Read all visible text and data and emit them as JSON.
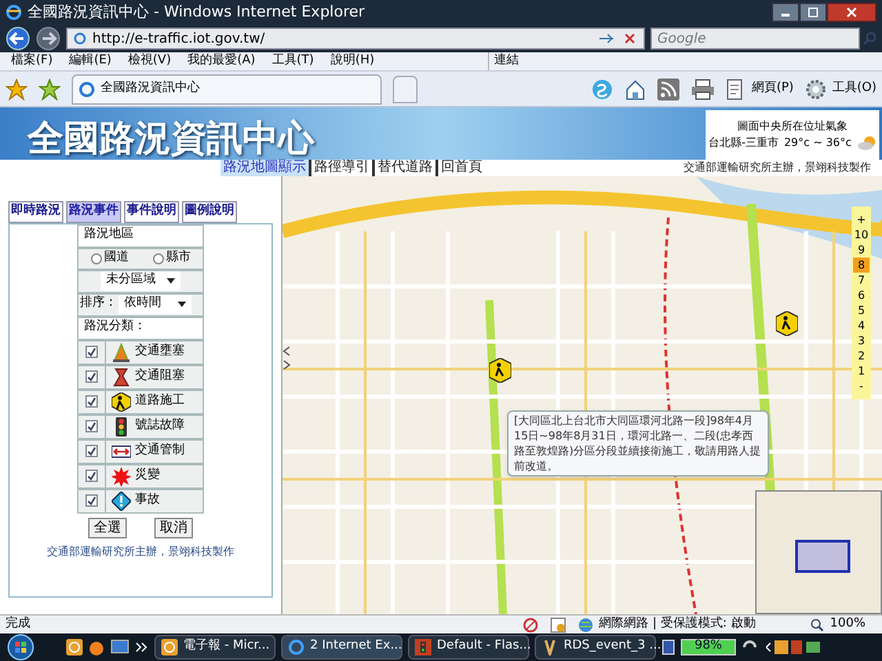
{
  "window": {
    "title": "全國路況資訊中心 - Windows Internet Explorer"
  },
  "address_bar": {
    "url": "http://e-traffic.iot.gov.tw/"
  },
  "search": {
    "placeholder": "Google"
  },
  "menu": [
    "檔案(F)",
    "編輯(E)",
    "檢視(V)",
    "我的最愛(A)",
    "工具(T)",
    "說明(H)"
  ],
  "links_label": "連結",
  "browser_tab": {
    "title": "全國路況資訊中心"
  },
  "toolbar_menus": [
    "網頁(P)",
    "工具(O)"
  ],
  "site": {
    "title": "全國路況資訊中心",
    "nav": [
      {
        "label": "路況地圖顯示",
        "selected": true
      },
      {
        "label": "路徑導引",
        "selected": false
      },
      {
        "label": "替代道路",
        "selected": false
      },
      {
        "label": "回首頁",
        "selected": false
      }
    ],
    "credit": "交通部運輸研究所主辦，景翊科技製作",
    "weather": {
      "heading": "圖面中央所在位址氣象",
      "location": "台北縣-三重市",
      "temp": "29°c ~ 36°c"
    }
  },
  "panel": {
    "tabs": [
      {
        "label": "即時路況",
        "selected": false
      },
      {
        "label": "路況事件",
        "selected": true
      },
      {
        "label": "事件說明",
        "selected": false
      },
      {
        "label": "圖例說明",
        "selected": false
      }
    ],
    "area_label": "路況地區",
    "area_options": [
      {
        "label": "國道",
        "selected": false
      },
      {
        "label": "縣市",
        "selected": false
      }
    ],
    "region": "未分區域",
    "sort_label": "排序：",
    "sort": "依時間",
    "category_label": "路況分類：",
    "categories": [
      {
        "kind": "cone",
        "label": "交通壅塞",
        "checked": true
      },
      {
        "kind": "jam",
        "label": "交通阻塞",
        "checked": true
      },
      {
        "kind": "work",
        "label": "道路施工",
        "checked": true
      },
      {
        "kind": "signal",
        "label": "號誌故障",
        "checked": true
      },
      {
        "kind": "control",
        "label": "交通管制",
        "checked": true
      },
      {
        "kind": "disaster",
        "label": "災變",
        "checked": true
      },
      {
        "kind": "accident",
        "label": "事故",
        "checked": true
      }
    ],
    "buttons": [
      "全選",
      "取消"
    ],
    "footer": "交通部運輸研究所主辦，景翊科技製作"
  },
  "map": {
    "popup": "[大同區北上台北市大同區環河北路一段]98年4月15日~98年8月31日，環河北路一、二段(忠孝西路至敦煌路)分區分段並續接衛施工，敬請用路人提前改道。",
    "zoom": {
      "plus": "+",
      "minus": "-",
      "levels": [
        {
          "label": "10",
          "selected": false
        },
        {
          "label": "9",
          "selected": false
        },
        {
          "label": "8",
          "selected": true
        },
        {
          "label": "7",
          "selected": false
        },
        {
          "label": "6",
          "selected": false
        },
        {
          "label": "5",
          "selected": false
        },
        {
          "label": "4",
          "selected": false
        },
        {
          "label": "3",
          "selected": false
        },
        {
          "label": "2",
          "selected": false
        },
        {
          "label": "1",
          "selected": false
        }
      ]
    }
  },
  "status_bar": {
    "text": "完成",
    "zone": "網際網路 | 受保護模式: 啟動",
    "zoom": "100%"
  },
  "taskbar": {
    "items": [
      {
        "label": "電子報 - Micr...",
        "selected": false
      },
      {
        "label": "2 Internet Ex...",
        "selected": true
      },
      {
        "label": "Default - Flas...",
        "selected": false
      },
      {
        "label": "RDS_event_3 ...",
        "selected": false
      }
    ],
    "battery": "98%"
  }
}
